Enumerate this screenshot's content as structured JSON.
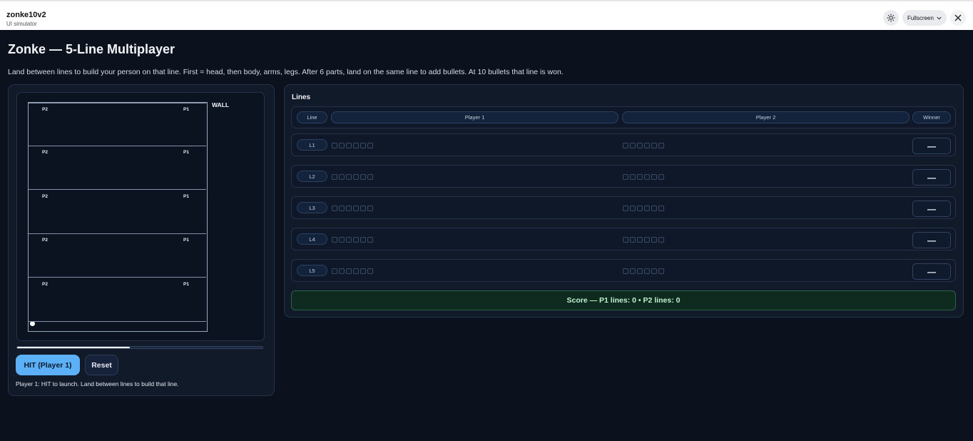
{
  "app": {
    "name": "zonke10v2",
    "subtitle": "UI simulator",
    "fullscreen_label": "Fullscreen"
  },
  "icons": {
    "theme": "sun-icon",
    "fullscreen_caret": "chevron-down-icon",
    "close": "close-icon"
  },
  "page": {
    "title": "Zonke — 5-Line Multiplayer",
    "description": "Land between lines to build your person on that line. First = head, then body, arms, legs. After 6 parts, land on the same line to add bullets. At 10 bullets that line is won."
  },
  "game": {
    "wall_label": "WALL",
    "lanes": [
      {
        "p2": "P2",
        "p1": "P1"
      },
      {
        "p2": "P2",
        "p1": "P1"
      },
      {
        "p2": "P2",
        "p1": "P1"
      },
      {
        "p2": "P2",
        "p1": "P1"
      },
      {
        "p2": "P2",
        "p1": "P1"
      }
    ],
    "power_fraction": 0.46,
    "hit_label": "HIT (Player 1)",
    "reset_label": "Reset",
    "hint": "Player 1: HIT to launch. Land between lines to build that line."
  },
  "lines": {
    "title": "Lines",
    "headers": {
      "line": "Line",
      "p1": "Player 1",
      "p2": "Player 2",
      "winner": "Winner"
    },
    "rows": [
      {
        "label": "L1",
        "winner": "—"
      },
      {
        "label": "L2",
        "winner": "—"
      },
      {
        "label": "L3",
        "winner": "—"
      },
      {
        "label": "L4",
        "winner": "—"
      },
      {
        "label": "L5",
        "winner": "—"
      }
    ],
    "slots_per_player": 6,
    "score": "Score — P1 lines: 0 • P2 lines: 0"
  },
  "colors": {
    "accent": "#5cb0f7",
    "background": "#0b111d",
    "score_bg": "#0f2a1f"
  }
}
